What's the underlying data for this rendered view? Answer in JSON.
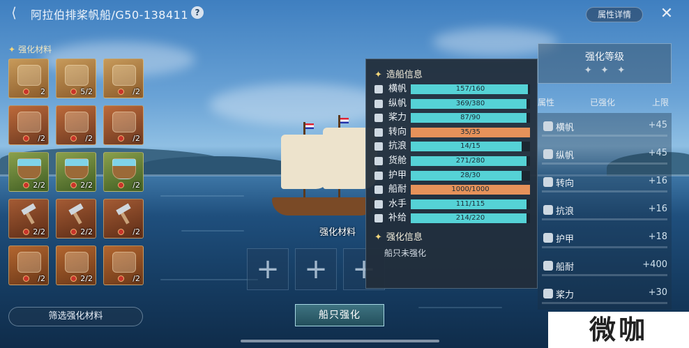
{
  "header": {
    "title": "阿拉伯排桨帆船/G50-138411",
    "help": "?",
    "attr_button": "属性详情",
    "close": "✕",
    "back": "⟨"
  },
  "materials": {
    "title": "强化材料",
    "items": [
      {
        "icon": "bucket-icon",
        "count": "2"
      },
      {
        "icon": "bucket-icon",
        "count": "5/2"
      },
      {
        "icon": "bucket-icon",
        "count": "/2"
      },
      {
        "icon": "basket-icon",
        "count": "/2"
      },
      {
        "icon": "basket-icon",
        "count": "/2"
      },
      {
        "icon": "basket-icon",
        "count": "/2"
      },
      {
        "icon": "water-bucket-icon",
        "count": "2/2"
      },
      {
        "icon": "water-bucket-icon",
        "count": "2/2"
      },
      {
        "icon": "water-bucket-icon",
        "count": "/2"
      },
      {
        "icon": "hammer-icon",
        "count": "2/2"
      },
      {
        "icon": "hammer-icon",
        "count": "2/2"
      },
      {
        "icon": "hammer-icon",
        "count": "/2"
      },
      {
        "icon": "ship-frame-icon",
        "count": "/2"
      },
      {
        "icon": "ship-frame-icon",
        "count": "2/2"
      },
      {
        "icon": "ship-frame-icon",
        "count": "/2"
      }
    ],
    "filter_button": "筛选强化材料"
  },
  "center": {
    "label": "强化材料",
    "slot_plus": "+",
    "enhance_button": "船只强化"
  },
  "info_panel": {
    "ship_info_title": "造船信息",
    "stats": [
      {
        "name": "横帆",
        "value": "157/160",
        "fill": 0.98,
        "full": false
      },
      {
        "name": "纵帆",
        "value": "369/380",
        "fill": 0.97,
        "full": false
      },
      {
        "name": "桨力",
        "value": "87/90",
        "fill": 0.97,
        "full": false
      },
      {
        "name": "转向",
        "value": "35/35",
        "fill": 1.0,
        "full": true
      },
      {
        "name": "抗浪",
        "value": "14/15",
        "fill": 0.93,
        "full": false
      },
      {
        "name": "货舱",
        "value": "271/280",
        "fill": 0.97,
        "full": false
      },
      {
        "name": "护甲",
        "value": "28/30",
        "fill": 0.93,
        "full": false
      },
      {
        "name": "船耐",
        "value": "1000/1000",
        "fill": 1.0,
        "full": true
      },
      {
        "name": "水手",
        "value": "111/115",
        "fill": 0.97,
        "full": false
      },
      {
        "name": "补给",
        "value": "214/220",
        "fill": 0.97,
        "full": false
      }
    ],
    "enhance_info_title": "强化信息",
    "enhance_note": "船只未强化"
  },
  "right_panel": {
    "level_title": "强化等级",
    "level_stars": "✦✦✦",
    "col_attr": "属性",
    "col_enhanced": "已强化",
    "col_limit": "上限",
    "rows": [
      {
        "name": "横帆",
        "value": "+45"
      },
      {
        "name": "纵帆",
        "value": "+45"
      },
      {
        "name": "转向",
        "value": "+16"
      },
      {
        "name": "抗浪",
        "value": "+16"
      },
      {
        "name": "护甲",
        "value": "+18"
      },
      {
        "name": "船耐",
        "value": "+400"
      },
      {
        "name": "桨力",
        "value": "+30"
      }
    ]
  },
  "watermark": "微咖",
  "colors": {
    "bar_normal": "#55d2d6",
    "bar_full": "#e6925a",
    "panel_bg": "#222e3a"
  }
}
